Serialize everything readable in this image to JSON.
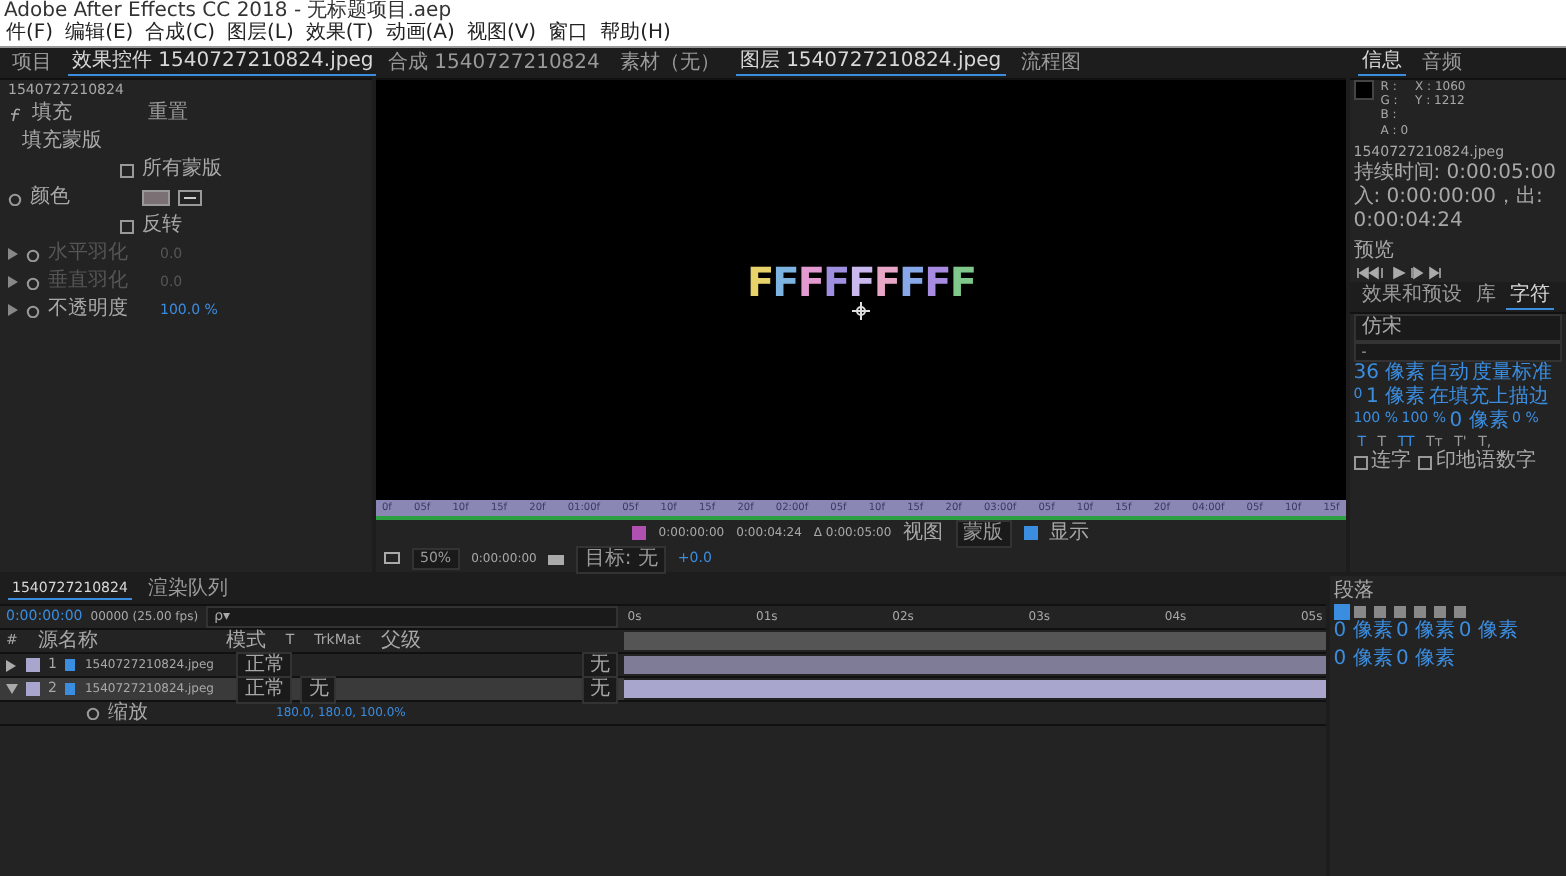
{
  "title_bar": {
    "title": "Adobe After Effects CC 2018 - 无标题项目.aep"
  },
  "menu": [
    "件(F)",
    "编辑(E)",
    "合成(C)",
    "图层(L)",
    "效果(T)",
    "动画(A)",
    "视图(V)",
    "窗口",
    "帮助(H)"
  ],
  "effect_controls": {
    "tabs": [
      {
        "label": "项目",
        "selected": false
      },
      {
        "label": "效果控件 1540727210824.jpeg",
        "selected": true
      }
    ],
    "layer": "1540727210824",
    "rows": [
      {
        "kind": "effect",
        "label": "填充",
        "value": "重置"
      },
      {
        "kind": "text",
        "label": "填充蒙版"
      },
      {
        "kind": "checkbox",
        "label": "所有蒙版",
        "checked": false
      },
      {
        "kind": "color",
        "label": "颜色",
        "color": "#7b7175"
      },
      {
        "kind": "checkbox",
        "label": "反转",
        "checked": false
      },
      {
        "kind": "value",
        "label": "水平羽化",
        "value": "0.0",
        "disabled": true
      },
      {
        "kind": "value",
        "label": "垂直羽化",
        "value": "0.0",
        "disabled": true
      },
      {
        "kind": "value",
        "label": "不透明度",
        "value": "100.0 %",
        "disabled": false
      }
    ]
  },
  "viewer": {
    "tabs": [
      {
        "label": "合成 1540727210824",
        "selected": false
      },
      {
        "label": "素材（无）",
        "selected": false
      },
      {
        "label": "图层 1540727210824.jpeg",
        "selected": true
      },
      {
        "label": "流程图",
        "selected": false
      }
    ],
    "letters": [
      {
        "text": "F",
        "color": "#e8d36a"
      },
      {
        "text": "F",
        "color": "#7db3e0"
      },
      {
        "text": "F",
        "color": "#e39ad0"
      },
      {
        "text": "F",
        "color": "#9f8fe0"
      },
      {
        "text": "F",
        "color": "#c9b8ee"
      },
      {
        "text": "F",
        "color": "#e7a6c6"
      },
      {
        "text": "F",
        "color": "#86a8e8"
      },
      {
        "text": "F",
        "color": "#a78be0"
      },
      {
        "text": "F",
        "color": "#7fc78a"
      }
    ],
    "ruler": [
      "0f",
      "05f",
      "10f",
      "15f",
      "20f",
      "01:00f",
      "05f",
      "10f",
      "15f",
      "20f",
      "02:00f",
      "05f",
      "10f",
      "15f",
      "20f",
      "03:00f",
      "05f",
      "10f",
      "15f",
      "20f",
      "04:00f",
      "05f",
      "10f",
      "15f"
    ],
    "in_time": "0:00:00:00",
    "out_time": "0:00:04:24",
    "duration": "Δ 0:00:05:00",
    "view_label": "视图",
    "view_value": "蒙版",
    "show_label": "显示",
    "show_checked": true,
    "zoom": "50%",
    "current_time": "0:00:00:00",
    "target": "目标: 无",
    "exposure": "+0.0"
  },
  "info": {
    "tabs": [
      {
        "label": "信息",
        "selected": true
      },
      {
        "label": "音频",
        "selected": false
      }
    ],
    "channels": [
      "R :",
      "G :",
      "B :",
      "A : 0"
    ],
    "x": "X : 1060",
    "y": "Y : 1212",
    "lines": [
      "1540727210824.jpeg",
      "持续时间: 0:00:05:00",
      "入: 0:00:00:00，出: 0:00:04:24"
    ]
  },
  "preview": {
    "title": "预览"
  },
  "character": {
    "tabs": [
      {
        "label": "效果和预设",
        "selected": false
      },
      {
        "label": "库",
        "selected": false
      },
      {
        "label": "字符",
        "selected": true
      }
    ],
    "font": "仿宋",
    "style": "-",
    "fields": [
      "36 像素",
      "自动",
      "度量标准",
      "0",
      "1 像素",
      "在填充上描边",
      "100 %",
      "100 %",
      "0 像素",
      "0 %"
    ],
    "styles": [
      {
        "label": "T",
        "selected": true
      },
      {
        "label": "T",
        "selected": false
      },
      {
        "label": "TT",
        "selected": true
      },
      {
        "label": "Tт",
        "selected": false
      },
      {
        "label": "T'",
        "selected": false
      },
      {
        "label": "T,",
        "selected": false
      }
    ],
    "options": [
      {
        "label": "连字",
        "checked": false
      },
      {
        "label": "印地语数字",
        "checked": false
      }
    ]
  },
  "timeline": {
    "tabs": [
      {
        "label": "1540727210824",
        "selected": true
      },
      {
        "label": "渲染队列",
        "selected": false
      }
    ],
    "time": "0:00:00:00",
    "fps": "00000 (25.00 fps)",
    "search_placeholder": "ρ▾",
    "columns": [
      "#",
      "源名称",
      "模式",
      "T",
      "TrkMat",
      "父级"
    ],
    "layers": [
      {
        "index": "1",
        "name": "1540727210824.jpeg",
        "mode": "正常",
        "parent": "无",
        "selected": false,
        "expanded": false
      },
      {
        "index": "2",
        "name": "1540727210824.jpeg",
        "mode": "正常",
        "trkmat": "无",
        "parent": "无",
        "selected": true,
        "expanded": true
      }
    ],
    "property": {
      "name": "缩放",
      "value": "180.0, 180.0, 100.0%"
    },
    "ruler": [
      "0s",
      "01s",
      "02s",
      "03s",
      "04s",
      "05s"
    ]
  },
  "paragraph": {
    "title": "段落",
    "fields": [
      "0 像素",
      "0 像素",
      "0 像素",
      "0 像素",
      "0 像素"
    ]
  }
}
